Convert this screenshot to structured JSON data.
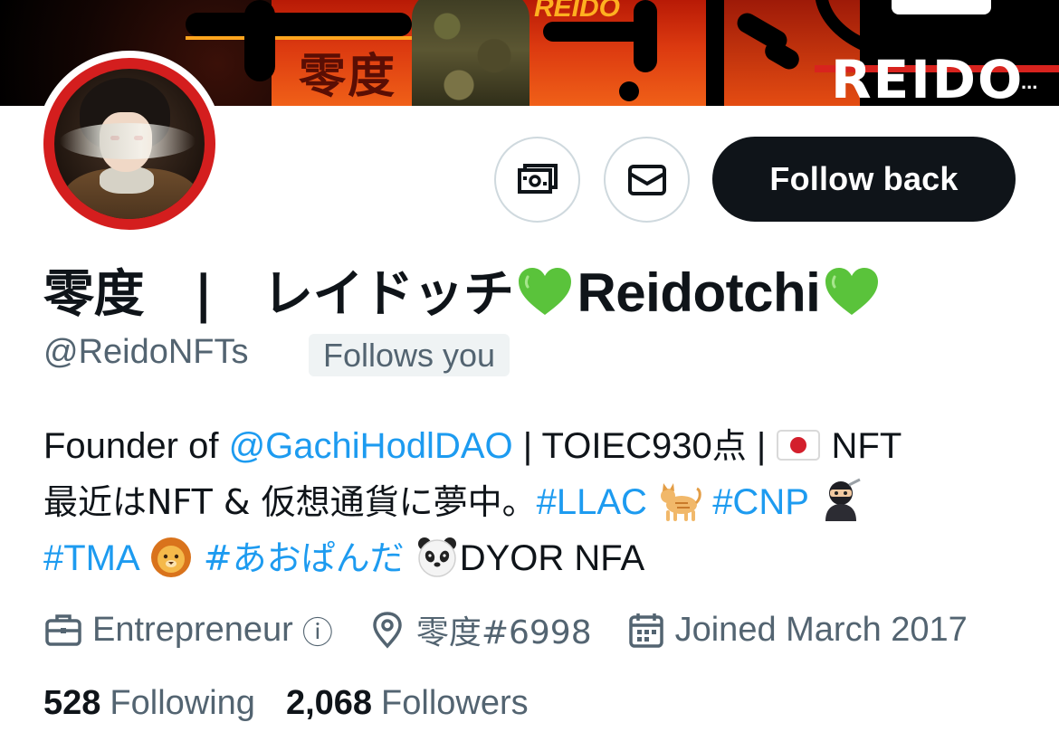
{
  "banner": {
    "kanji": "零度",
    "reido_small": "REIDO",
    "reido_big": "REIDO",
    "reido_dots": "..."
  },
  "actions": {
    "tip_icon": "money-icon",
    "message_icon": "envelope-icon",
    "follow_label": "Follow back"
  },
  "profile": {
    "name_jp": "零度　|　レイドッチ",
    "name_latin": "Reidotchi",
    "name_emoji": "green-heart",
    "handle": "@ReidoNFTs",
    "follows_you": "Follows you"
  },
  "bio": {
    "l1_a": "Founder of ",
    "l1_mention": "@GachiHodlDAO",
    "l1_b": " | TOIEC930",
    "l1_c": "点",
    "l1_d": " | ",
    "l1_e": " NFT",
    "l2_a": "最近はNFT & 仮想通貨に夢中。",
    "l2_tag1": "#LLAC",
    "l2_tag2": "#CNP",
    "l3_tag1": "#TMA",
    "l3_tag2": "#あおぱんだ",
    "l3_b": "DYOR NFA",
    "emojis": [
      "japan-flag",
      "cat",
      "ninja",
      "lion",
      "panda"
    ]
  },
  "meta": {
    "profession": "Entrepreneur",
    "info_glyph": "ⓘ",
    "location": "零度#6998",
    "joined": "Joined March 2017"
  },
  "stats": {
    "following_count": "528",
    "following_label": "Following",
    "followers_count": "2,068",
    "followers_label": "Followers"
  },
  "colors": {
    "link": "#1d9bf0",
    "muted": "#536471",
    "text": "#0f1419",
    "heart": "#5ac33b"
  }
}
